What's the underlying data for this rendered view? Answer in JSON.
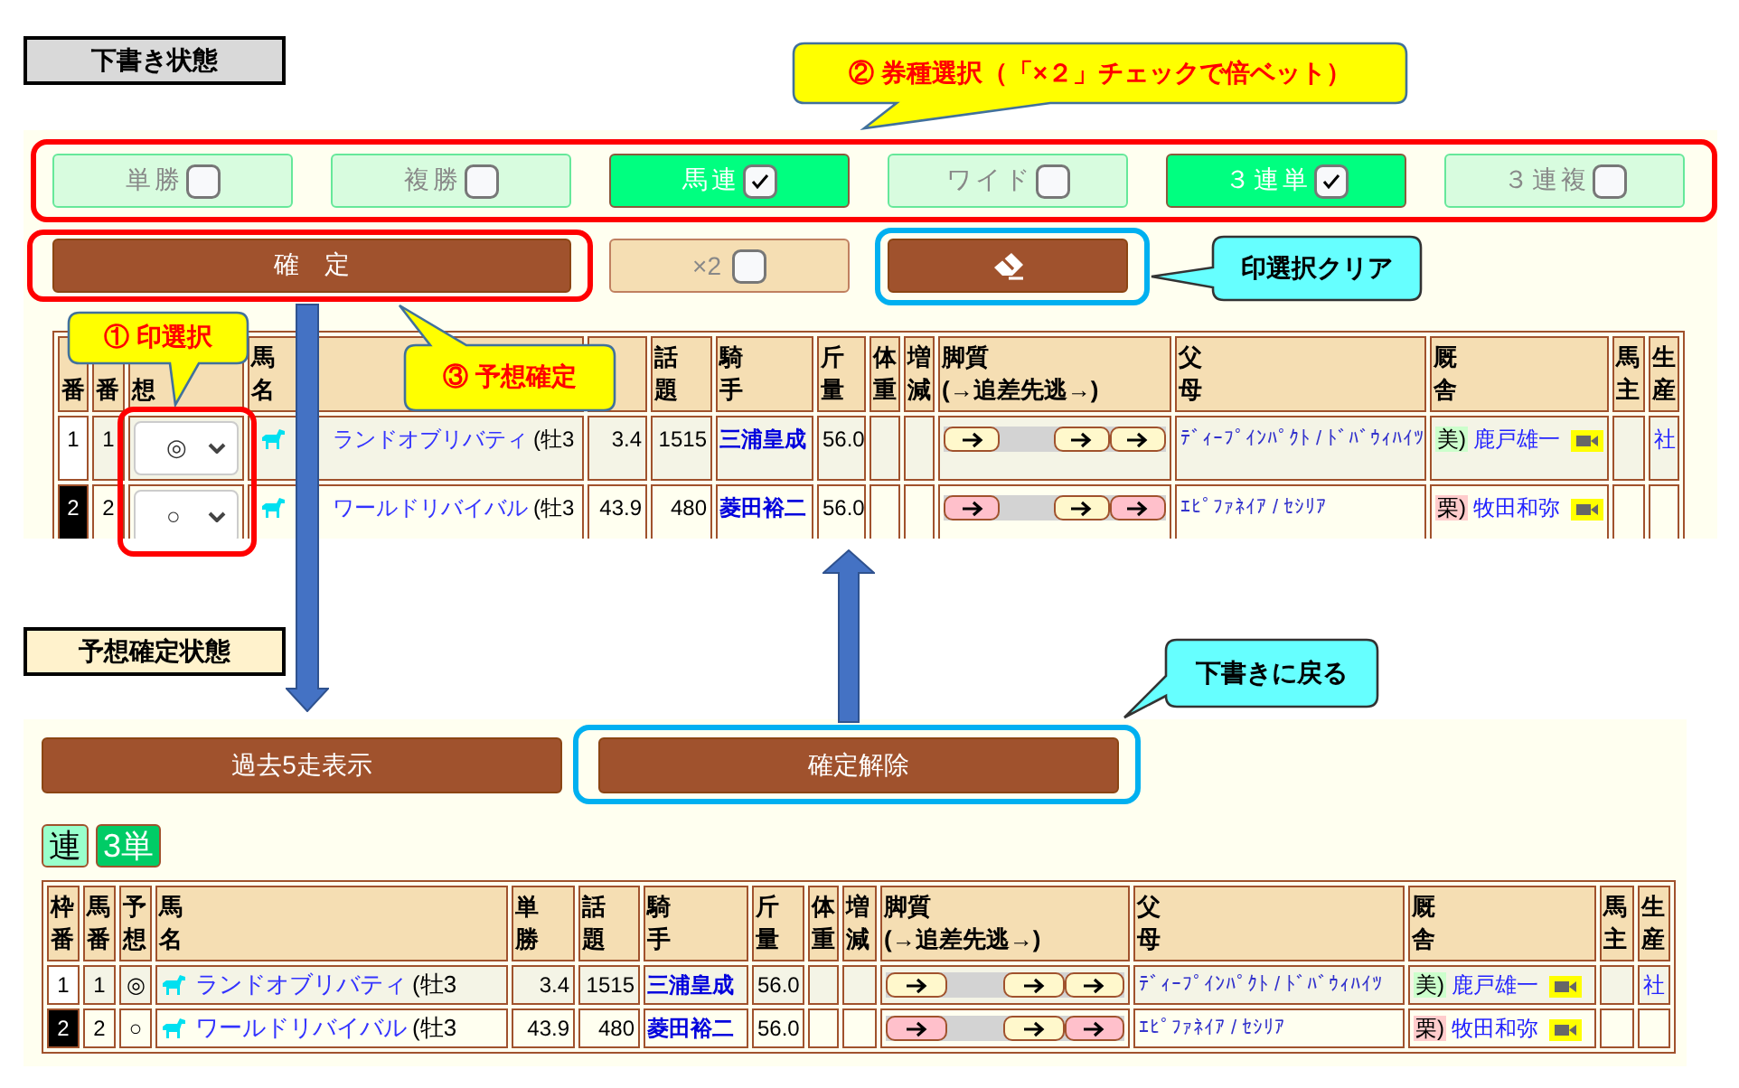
{
  "draft": {
    "label": "下書き状態",
    "bet_types": [
      {
        "label": "単勝",
        "checked": false
      },
      {
        "label": "複勝",
        "checked": false
      },
      {
        "label": "馬連",
        "checked": true
      },
      {
        "label": "ワイド",
        "checked": false
      },
      {
        "label": "３連単",
        "checked": true
      },
      {
        "label": "３連複",
        "checked": false
      }
    ],
    "confirm_button": "確　定",
    "double_bet": {
      "label": "×2",
      "checked": false
    },
    "table": {
      "columns": [
        {
          "lines": [
            "番"
          ]
        },
        {
          "lines": [
            "番"
          ]
        },
        {
          "lines": [
            "想"
          ]
        },
        {
          "lines": [
            "馬",
            "名"
          ]
        },
        {},
        {
          "lines": [
            "話",
            "題"
          ]
        },
        {
          "lines": [
            "騎",
            "手"
          ]
        },
        {
          "lines": [
            "斤",
            "量"
          ]
        },
        {
          "lines": [
            "体",
            "重"
          ]
        },
        {
          "lines": [
            "増",
            "減"
          ]
        },
        {
          "lines": [
            "脚質",
            "(→追差先逃→)"
          ]
        },
        {
          "lines": [
            "父",
            "母"
          ]
        },
        {
          "lines": [
            "厩",
            "舎"
          ]
        },
        {
          "lines": [
            "馬",
            "主"
          ]
        },
        {
          "lines": [
            "生",
            "産"
          ]
        }
      ],
      "rows": [
        {
          "frame": {
            "number": "1",
            "color": "#ffffff"
          },
          "horse_number": "1",
          "mark": "◎",
          "name": "ランドオブリバティ",
          "sex_age": "(牡3",
          "odds": "3.4",
          "topic": "1515",
          "jockey": "三浦皇成",
          "weight": "56.0",
          "running_style": [
            {
              "kind": "marker",
              "color": "#fff8cc"
            },
            {
              "kind": "gap"
            },
            {
              "kind": "marker",
              "color": "#fff8cc"
            },
            {
              "kind": "marker",
              "color": "#fff8cc"
            }
          ],
          "pedigree": "ﾃﾞｨｰﾌﾟｲﾝﾊﾟｸﾄ / ﾄﾞﾊﾞｳｨﾊｲﾂ",
          "stable": {
            "region": "美)",
            "color": "#ccffcc",
            "trainer": "鹿戸雄一"
          },
          "breeder": "社"
        },
        {
          "frame": {
            "number": "2",
            "color": "#000000"
          },
          "horse_number": "2",
          "mark": "○",
          "name": "ワールドリバイバル",
          "sex_age": "(牡3",
          "odds": "43.9",
          "topic": "480",
          "jockey": "菱田裕二",
          "weight": "56.0",
          "running_style": [
            {
              "kind": "marker",
              "color": "#ffc0cb"
            },
            {
              "kind": "gap"
            },
            {
              "kind": "marker",
              "color": "#fff8cc"
            },
            {
              "kind": "marker",
              "color": "#ffc0cb"
            }
          ],
          "pedigree": "ｴﾋﾟﾌｧﾈｲｱ / ｾｼﾘｱ",
          "stable": {
            "region": "栗)",
            "color": "#ffcccc",
            "trainer": "牧田和弥"
          }
        }
      ]
    }
  },
  "confirmed": {
    "label": "予想確定状態",
    "buttons": [
      "過去5走表示",
      "確定解除"
    ],
    "bet_badges": [
      {
        "label": "連",
        "color": "#99ffcc"
      },
      {
        "label": "3単",
        "color": "#00cc66"
      }
    ],
    "table": {
      "columns": [
        {
          "lines": [
            "枠",
            "番"
          ]
        },
        {
          "lines": [
            "馬",
            "番"
          ]
        },
        {
          "lines": [
            "予",
            "想"
          ]
        },
        {
          "lines": [
            "馬",
            "名"
          ]
        },
        {
          "lines": [
            "単",
            "勝"
          ]
        },
        {
          "lines": [
            "話",
            "題"
          ]
        },
        {
          "lines": [
            "騎",
            "手"
          ]
        },
        {
          "lines": [
            "斤",
            "量"
          ]
        },
        {
          "lines": [
            "体",
            "重"
          ]
        },
        {
          "lines": [
            "増",
            "減"
          ]
        },
        {
          "lines": [
            "脚質",
            "(→追差先逃→)"
          ]
        },
        {
          "lines": [
            "父",
            "母"
          ]
        },
        {
          "lines": [
            "厩",
            "舎"
          ]
        },
        {
          "lines": [
            "馬",
            "主"
          ]
        },
        {
          "lines": [
            "生",
            "産"
          ]
        }
      ],
      "rows": [
        {
          "frame": {
            "number": "1",
            "color": "#ffffff"
          },
          "horse_number": "1",
          "mark": "◎",
          "name": "ランドオブリバティ",
          "sex_age": "(牡3",
          "odds": "3.4",
          "topic": "1515",
          "jockey": "三浦皇成",
          "weight": "56.0",
          "running_style": [
            {
              "kind": "marker",
              "color": "#fff8cc"
            },
            {
              "kind": "gap"
            },
            {
              "kind": "marker",
              "color": "#fff8cc"
            },
            {
              "kind": "marker",
              "color": "#fff8cc"
            }
          ],
          "pedigree": "ﾃﾞｨｰﾌﾟｲﾝﾊﾟｸﾄ / ﾄﾞﾊﾞｳｨﾊｲﾂ",
          "stable": {
            "region": "美)",
            "color": "#ccffcc",
            "trainer": "鹿戸雄一"
          },
          "breeder": "社"
        },
        {
          "frame": {
            "number": "2",
            "color": "#000000"
          },
          "horse_number": "2",
          "mark": "○",
          "name": "ワールドリバイバル",
          "sex_age": "(牡3",
          "odds": "43.9",
          "topic": "480",
          "jockey": "菱田裕二",
          "weight": "56.0",
          "running_style": [
            {
              "kind": "marker",
              "color": "#ffc0cb"
            },
            {
              "kind": "gap"
            },
            {
              "kind": "marker",
              "color": "#fff8cc"
            },
            {
              "kind": "marker",
              "color": "#ffc0cb"
            }
          ],
          "pedigree": "ｴﾋﾟﾌｧﾈｲｱ / ｾｼﾘｱ",
          "stable": {
            "region": "栗)",
            "color": "#ffcccc",
            "trainer": "牧田和弥"
          }
        }
      ]
    }
  },
  "callouts": [
    {
      "kind": "step",
      "text": "② 券種選択（「×２」チェックで倍ベット）"
    },
    {
      "kind": "tip",
      "text": "印選択クリア"
    },
    {
      "kind": "step",
      "text": "① 印選択"
    },
    {
      "kind": "step",
      "text": "③ 予想確定"
    },
    {
      "kind": "tip",
      "text": "下書きに戻る"
    }
  ]
}
